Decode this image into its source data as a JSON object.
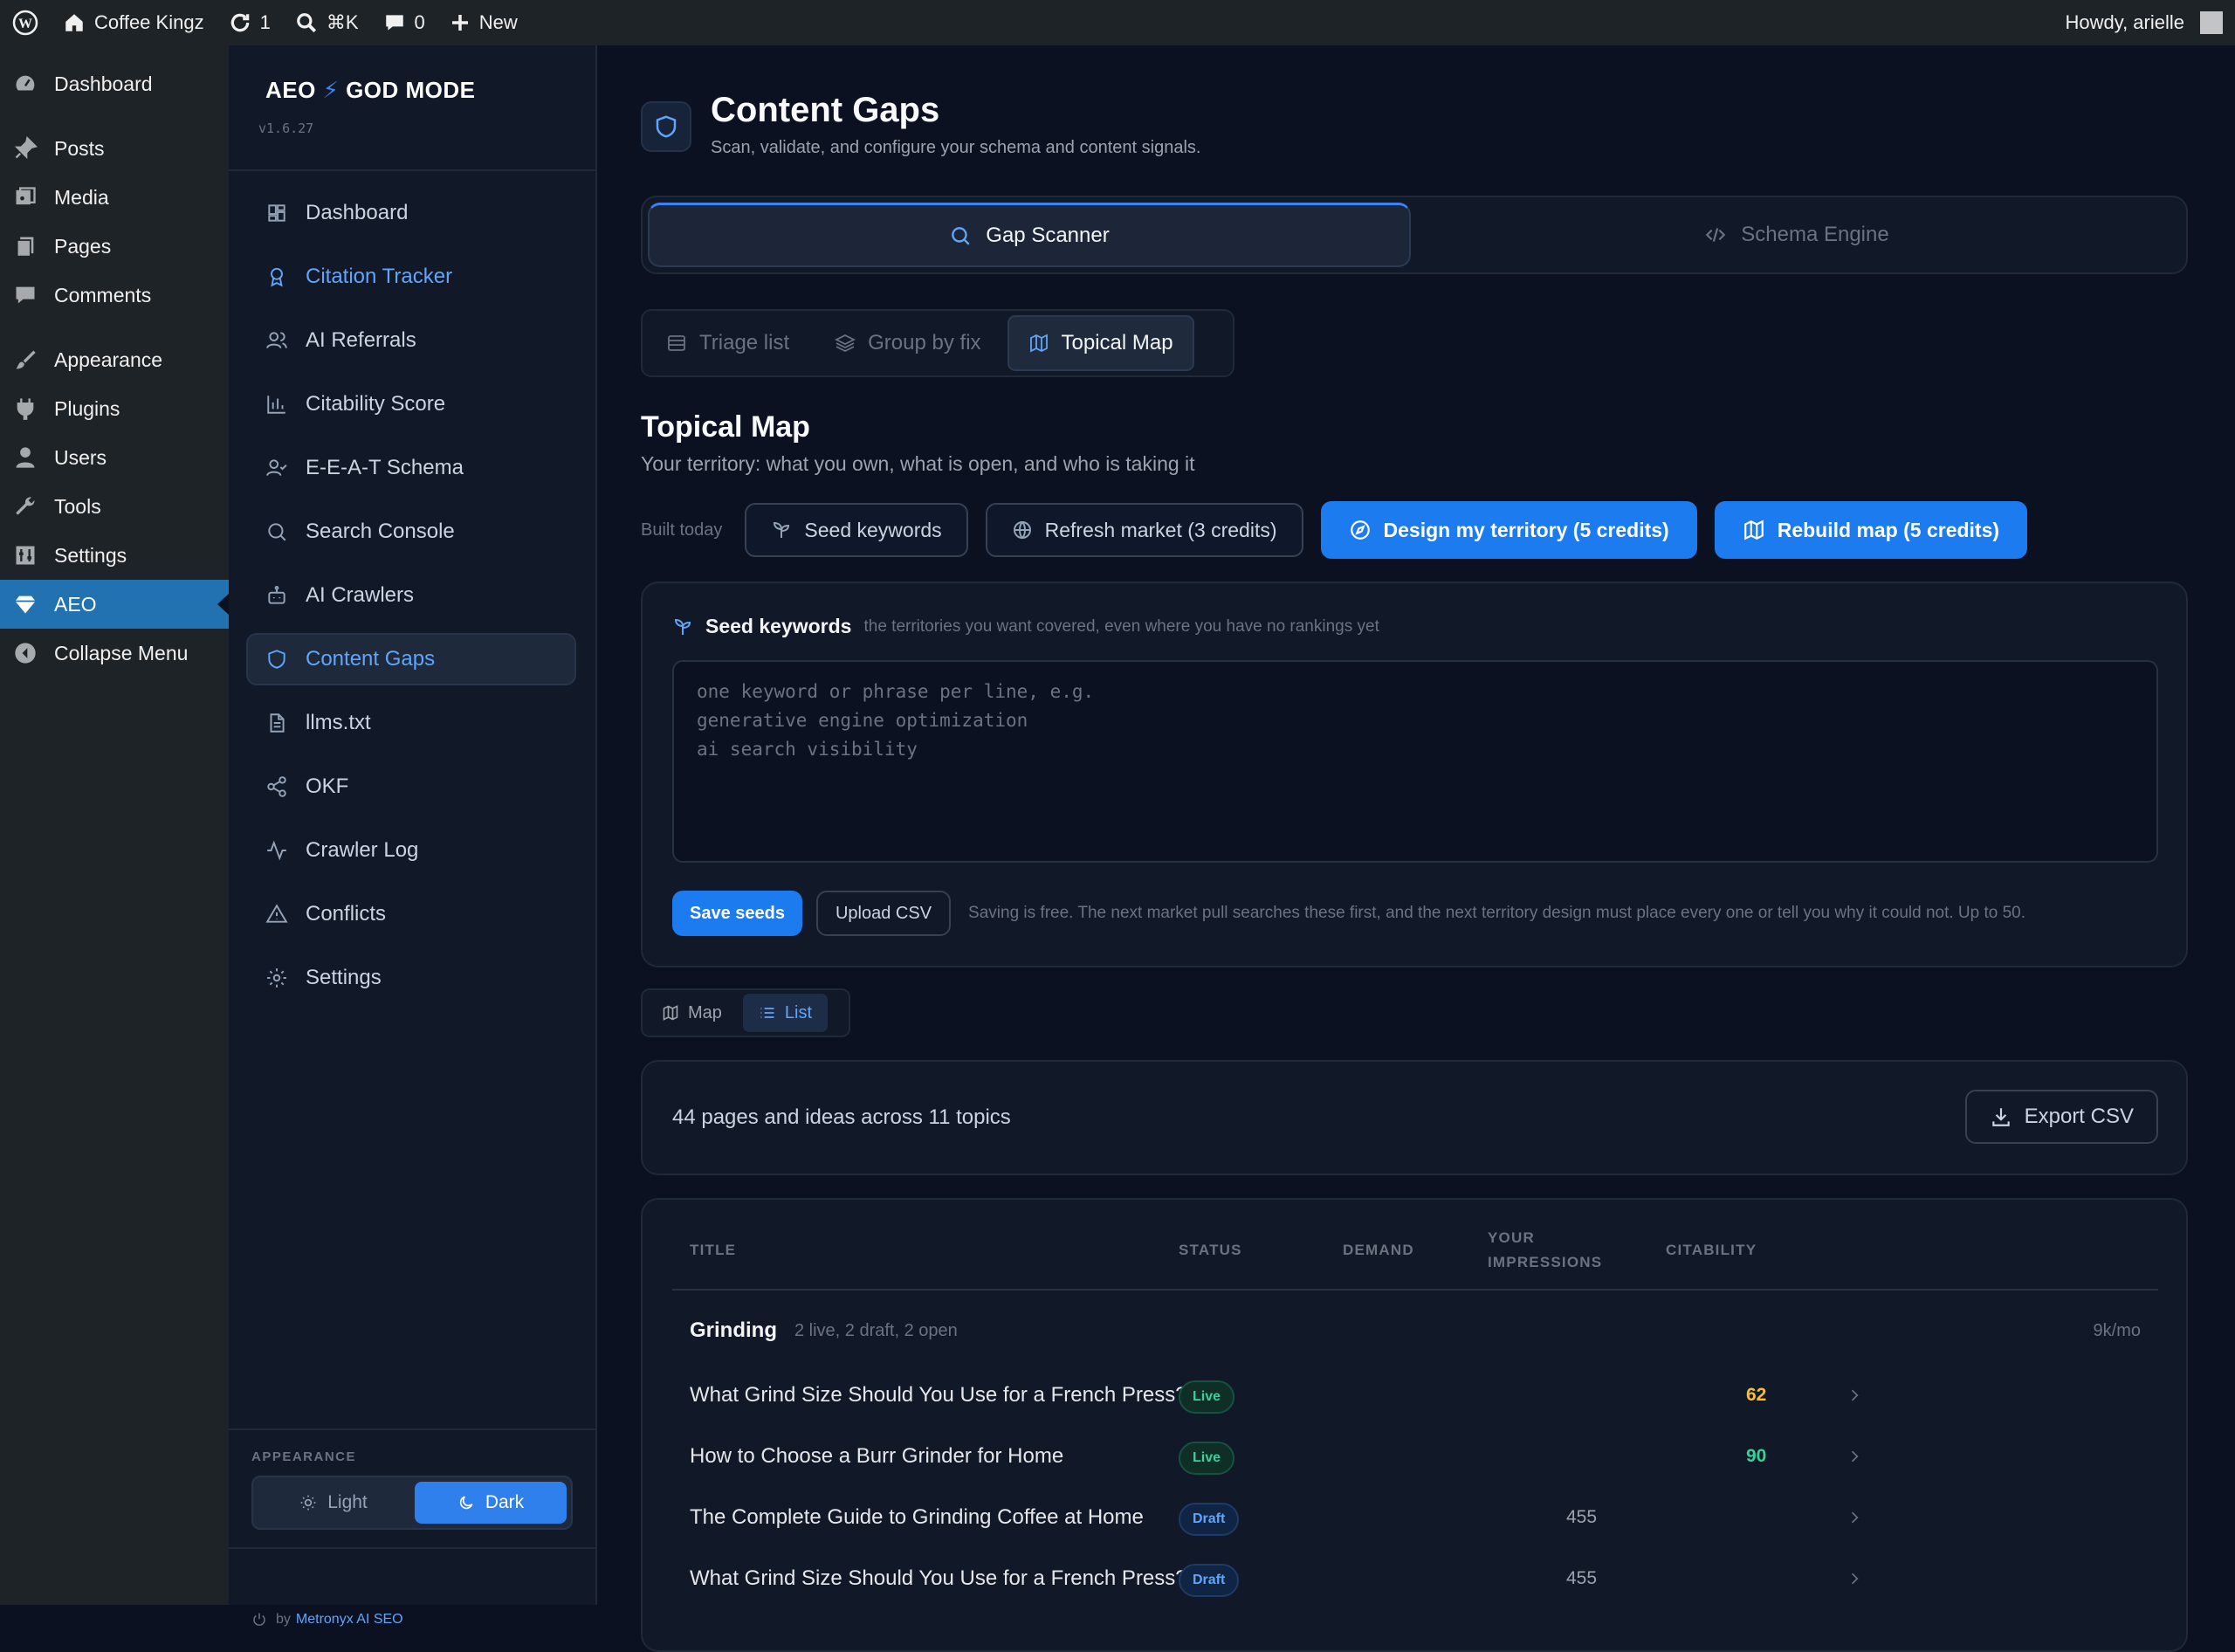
{
  "admin_bar": {
    "site_name": "Coffee Kingz",
    "updates_count": "1",
    "search_shortcut": "⌘K",
    "comments_count": "0",
    "new_label": "New",
    "howdy": "Howdy, arielle"
  },
  "wp_menu": {
    "items": [
      {
        "label": "Dashboard",
        "icon": "dashboard-icon"
      },
      {
        "label": "Posts",
        "icon": "pin-icon"
      },
      {
        "label": "Media",
        "icon": "media-icon"
      },
      {
        "label": "Pages",
        "icon": "pages-icon"
      },
      {
        "label": "Comments",
        "icon": "comments-icon"
      },
      {
        "label": "Appearance",
        "icon": "brush-icon"
      },
      {
        "label": "Plugins",
        "icon": "plug-icon"
      },
      {
        "label": "Users",
        "icon": "user-icon"
      },
      {
        "label": "Tools",
        "icon": "wrench-icon"
      },
      {
        "label": "Settings",
        "icon": "settings-icon"
      },
      {
        "label": "AEO",
        "icon": "diamond-icon"
      },
      {
        "label": "Collapse Menu",
        "icon": "collapse-icon"
      }
    ]
  },
  "sidebar": {
    "brand_left": "AEO",
    "brand_bolt": "⚡",
    "brand_right": "GOD MODE",
    "version": "v1.6.27",
    "items": [
      {
        "label": "Dashboard",
        "icon": "grid-icon"
      },
      {
        "label": "Citation Tracker",
        "icon": "award-icon"
      },
      {
        "label": "AI Referrals",
        "icon": "users-icon"
      },
      {
        "label": "Citability Score",
        "icon": "bar-chart-icon"
      },
      {
        "label": "E-E-A-T Schema",
        "icon": "user-check-icon"
      },
      {
        "label": "Search Console",
        "icon": "search-icon"
      },
      {
        "label": "AI Crawlers",
        "icon": "bot-icon"
      },
      {
        "label": "Content Gaps",
        "icon": "shield-icon"
      },
      {
        "label": "llms.txt",
        "icon": "file-text-icon"
      },
      {
        "label": "OKF",
        "icon": "share-icon"
      },
      {
        "label": "Crawler Log",
        "icon": "activity-icon"
      },
      {
        "label": "Conflicts",
        "icon": "warning-icon"
      },
      {
        "label": "Settings",
        "icon": "gear-icon"
      }
    ],
    "appearance_label": "APPEARANCE",
    "light_label": "Light",
    "dark_label": "Dark",
    "by_prefix": "by",
    "by_link": "Metronyx AI SEO"
  },
  "header": {
    "title": "Content Gaps",
    "subtitle": "Scan, validate, and configure your schema and content signals."
  },
  "main_tabs": {
    "gap_scanner": "Gap Scanner",
    "schema_engine": "Schema Engine"
  },
  "view_tabs": {
    "triage": "Triage list",
    "group": "Group by fix",
    "topical": "Topical Map"
  },
  "topical_map": {
    "title": "Topical Map",
    "subtitle": "Your territory: what you own, what is open, and who is taking it",
    "built": "Built today",
    "seed_btn": "Seed keywords",
    "refresh_btn": "Refresh market (3 credits)",
    "design_btn": "Design my territory (5 credits)",
    "rebuild_btn": "Rebuild map (5 credits)"
  },
  "seed": {
    "title": "Seed keywords",
    "desc": "the territories you want covered, even where you have no rankings yet",
    "placeholder": "one keyword or phrase per line, e.g.\ngenerative engine optimization\nai search visibility",
    "save": "Save seeds",
    "upload": "Upload CSV",
    "note": "Saving is free. The next market pull searches these first, and the next territory design must place every one or tell you why it could not. Up to 50."
  },
  "mode": {
    "map": "Map",
    "list": "List"
  },
  "summary": {
    "text": "44 pages and ideas across 11 topics",
    "export": "Export CSV"
  },
  "table": {
    "headers": {
      "title": "TITLE",
      "status": "STATUS",
      "demand": "DEMAND",
      "impressions_1": "YOUR",
      "impressions_2": "IMPRESSIONS",
      "citability": "CITABILITY"
    },
    "group": {
      "name": "Grinding",
      "meta": "2 live, 2 draft, 2 open",
      "demand": "9k/mo"
    },
    "rows": [
      {
        "title": "What Grind Size Should You Use for a French Press?",
        "status": "Live",
        "impressions": "",
        "citability": "62"
      },
      {
        "title": "How to Choose a Burr Grinder for Home",
        "status": "Live",
        "impressions": "",
        "citability": "90"
      },
      {
        "title": "The Complete Guide to Grinding Coffee at Home",
        "status": "Draft",
        "impressions": "455",
        "citability": ""
      },
      {
        "title": "What Grind Size Should You Use for a French Press?",
        "status": "Draft",
        "impressions": "455",
        "citability": ""
      }
    ]
  },
  "colors": {
    "accent": "#1d7bf0",
    "live": "#34d399",
    "draft": "#60a5fa",
    "citability_mid": "#fbbf24",
    "citability_high": "#34d399"
  }
}
